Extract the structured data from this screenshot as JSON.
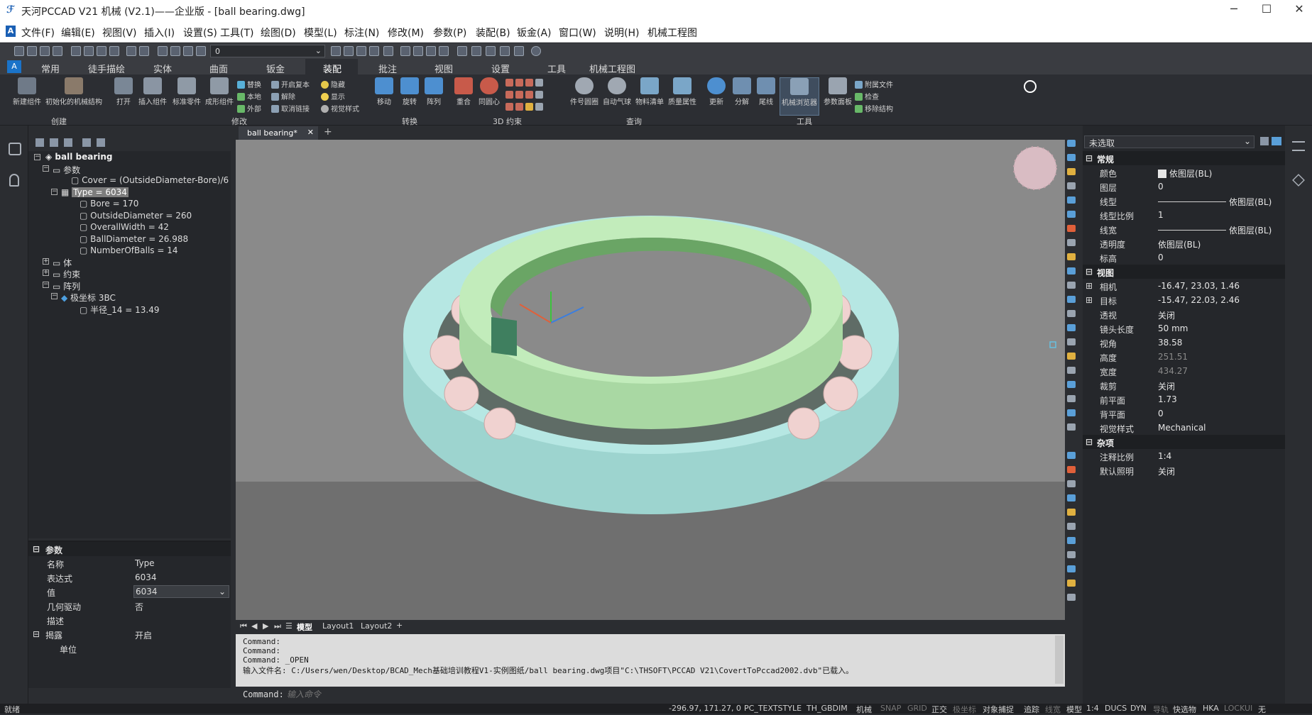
{
  "window": {
    "title": "天河PCCAD V21 机械 (V2.1)——企业版 - [ball bearing.dwg]"
  },
  "menu": [
    "文件(F)",
    "编辑(E)",
    "视图(V)",
    "插入(I)",
    "设置(S)",
    "工具(T)",
    "绘图(D)",
    "模型(L)",
    "标注(N)",
    "修改(M)",
    "参数(P)",
    "装配(B)",
    "钣金(A)",
    "窗口(W)",
    "说明(H)",
    "机械工程图"
  ],
  "quick_toolbar": {
    "layer_value": "0"
  },
  "ribbon_tabs": [
    "常用",
    "徒手描绘",
    "实体",
    "曲面",
    "钣金",
    "装配",
    "批注",
    "视图",
    "设置",
    "工具",
    "机械工程图"
  ],
  "active_tab": "装配",
  "ribbon": {
    "buttons": [
      "新建组件",
      "初始化的机械结构",
      "打开",
      "插入组件",
      "标准零件",
      "成形组件",
      "移动",
      "旋转",
      "阵列",
      "重合",
      "同圆心",
      "件号圆圈",
      "自动气球",
      "物料清单",
      "质量属性",
      "更新",
      "分解",
      "尾线",
      "机械浏览器",
      "参数面板"
    ],
    "small_col1": [
      "替换",
      "本地",
      "外部"
    ],
    "small_col2": [
      "开启复本",
      "解除",
      "取消链接"
    ],
    "small_col3": [
      "隐藏",
      "显示",
      "视觉样式"
    ],
    "small_col4": [
      "附属文件",
      "检查",
      "移除结构"
    ],
    "groups": [
      "创建",
      "修改",
      "转换",
      "3D 约束",
      "查询",
      "工具"
    ]
  },
  "tree": {
    "root": "ball bearing",
    "params_folder": "参数",
    "cover": "Cover = (OutsideDiameter-Bore)/6",
    "type": "Type = 6034",
    "bore": "Bore = 170",
    "outside": "OutsideDiameter = 260",
    "width": "OverallWidth = 42",
    "ball": "BallDiameter = 26.988",
    "nballs": "NumberOfBalls = 14",
    "body": "体",
    "constraint": "约束",
    "array": "阵列",
    "polar": "极坐标 3BC",
    "radius": "半径_14 = 13.49"
  },
  "param_panel": {
    "header": "参数",
    "rows": [
      {
        "k": "名称",
        "v": "Type"
      },
      {
        "k": "表达式",
        "v": "6034"
      },
      {
        "k": "值",
        "v": "6034"
      },
      {
        "k": "几何驱动",
        "v": "否"
      },
      {
        "k": "描述",
        "v": ""
      }
    ],
    "expose_header": "揭露",
    "expose_value": "开启",
    "unit": "单位"
  },
  "doc_tab": "ball bearing*",
  "layout_tabs": [
    "模型",
    "Layout1",
    "Layout2"
  ],
  "command": {
    "lines": [
      "Command:",
      "Command:",
      "Command: _OPEN",
      "输入文件名: C:/Users/wen/Desktop/BCAD_Mech基础培训教程V1-实例图纸/ball bearing.dwg项目\"C:\\THSOFT\\PCCAD V21\\CovertToPccad2002.dvb\"已载入。"
    ],
    "prompt": "Command:",
    "placeholder": "输入命令"
  },
  "props": {
    "selector": "未选取",
    "general_header": "常规",
    "general": [
      {
        "k": "颜色",
        "v": "依图层(BL)"
      },
      {
        "k": "图层",
        "v": "0"
      },
      {
        "k": "线型",
        "v": "依图层(BL)"
      },
      {
        "k": "线型比例",
        "v": "1"
      },
      {
        "k": "线宽",
        "v": "依图层(BL)"
      },
      {
        "k": "透明度",
        "v": "依图层(BL)"
      },
      {
        "k": "标高",
        "v": "0"
      }
    ],
    "view_header": "视图",
    "view": [
      {
        "k": "相机",
        "v": "-16.47, 23.03, 1.46"
      },
      {
        "k": "目标",
        "v": "-15.47, 22.03, 2.46"
      },
      {
        "k": "透视",
        "v": "关闭"
      },
      {
        "k": "镜头长度",
        "v": "50 mm"
      },
      {
        "k": "视角",
        "v": "38.58"
      },
      {
        "k": "高度",
        "v": "251.51"
      },
      {
        "k": "宽度",
        "v": "434.27"
      },
      {
        "k": "裁剪",
        "v": "关闭"
      },
      {
        "k": "前平面",
        "v": "1.73"
      },
      {
        "k": "背平面",
        "v": "0"
      },
      {
        "k": "视觉样式",
        "v": "Mechanical"
      }
    ],
    "misc_header": "杂项",
    "misc": [
      {
        "k": "注释比例",
        "v": "1:4"
      },
      {
        "k": "默认照明",
        "v": "关闭"
      }
    ]
  },
  "status": {
    "left": "就绪",
    "coords": "-296.97, 171.27, 0",
    "items": [
      "PC_TEXTSTYLE",
      "TH_GBDIM",
      "机械",
      "SNAP",
      "GRID",
      "正交",
      "极坐标",
      "对象捕捉",
      "追踪",
      "线宽",
      "模型",
      "1:4",
      "DUCS",
      "DYN",
      "导轨",
      "快选物",
      "HKA",
      "LOCKUI",
      "无"
    ]
  },
  "colors": {
    "outer_ring": "#aee3df",
    "inner_ring": "#b9e8b3",
    "balls": "#f0d2d0",
    "viewport_bg": "#8a8a8a",
    "panel_bg": "#25272b"
  }
}
